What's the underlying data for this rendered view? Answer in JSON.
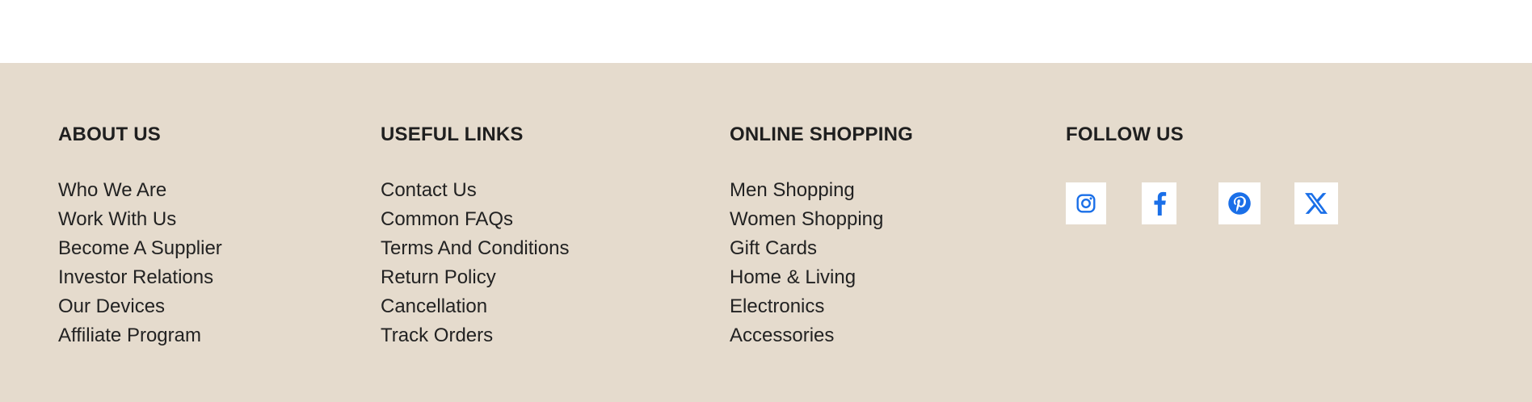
{
  "footer": {
    "about": {
      "heading": "ABOUT US",
      "links": [
        "Who We Are",
        "Work With Us",
        "Become A Supplier",
        "Investor Relations",
        "Our Devices",
        "Affiliate Program"
      ]
    },
    "useful": {
      "heading": "USEFUL LINKS",
      "links": [
        "Contact Us",
        "Common FAQs",
        "Terms And Conditions",
        "Return Policy",
        "Cancellation",
        "Track Orders"
      ]
    },
    "shopping": {
      "heading": "ONLINE SHOPPING",
      "links": [
        "Men Shopping",
        "Women Shopping",
        "Gift Cards",
        "Home & Living",
        "Electronics",
        "Accessories"
      ]
    },
    "follow": {
      "heading": "FOLLOW US",
      "icons": [
        "instagram-icon",
        "facebook-icon",
        "pinterest-icon",
        "x-icon"
      ]
    }
  },
  "colors": {
    "footer_background": "#e5dbcd",
    "social_icon": "#1a6fe8",
    "social_tile": "#ffffff",
    "text": "#212121"
  }
}
